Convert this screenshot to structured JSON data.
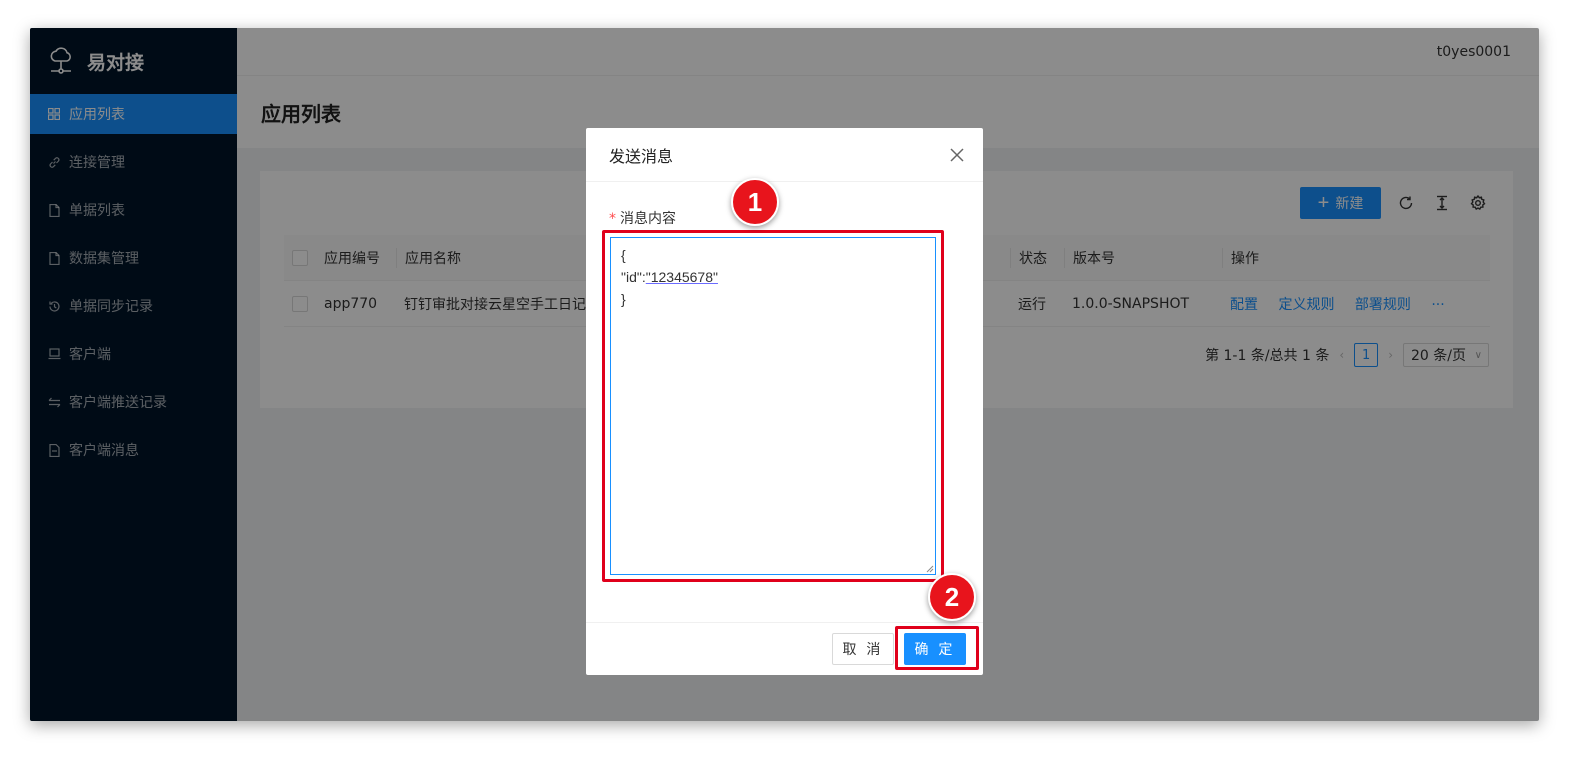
{
  "app": {
    "name": "易对接",
    "user": "t0yes0001"
  },
  "sidebar": {
    "items": [
      {
        "label": "应用列表",
        "icon": "grid-icon",
        "active": true
      },
      {
        "label": "连接管理",
        "icon": "link-icon",
        "active": false
      },
      {
        "label": "单据列表",
        "icon": "file-icon",
        "active": false
      },
      {
        "label": "数据集管理",
        "icon": "file-icon",
        "active": false
      },
      {
        "label": "单据同步记录",
        "icon": "history-icon",
        "active": false
      },
      {
        "label": "客户端",
        "icon": "laptop-icon",
        "active": false
      },
      {
        "label": "客户端推送记录",
        "icon": "swap-icon",
        "active": false
      },
      {
        "label": "客户端消息",
        "icon": "file-text-icon",
        "active": false
      }
    ]
  },
  "page": {
    "title": "应用列表"
  },
  "toolbar": {
    "new_label": "新建"
  },
  "table": {
    "columns": [
      "应用编号",
      "应用名称",
      "状态",
      "版本号",
      "操作"
    ],
    "rows": [
      {
        "code": "app770",
        "name": "钉钉审批对接云星空手工日记",
        "status": "运行",
        "version": "1.0.0-SNAPSHOT",
        "actions": [
          "配置",
          "定义规则",
          "部署规则"
        ],
        "more": "···"
      }
    ]
  },
  "pagination": {
    "summary": "第 1-1 条/总共 1 条",
    "current": "1",
    "page_size": "20 条/页"
  },
  "modal": {
    "title": "发送消息",
    "field_label": "消息内容",
    "required_mark": "*",
    "content_lines": [
      "{",
      "\"id\":",
      "\"12345678\"",
      "}"
    ],
    "cancel_label": "取 消",
    "ok_label": "确 定"
  },
  "annotations": {
    "step1": "1",
    "step2": "2",
    "highlight_color": "#e0001b"
  },
  "colors": {
    "sidebar_bg": "#001529",
    "primary": "#1890ff"
  }
}
